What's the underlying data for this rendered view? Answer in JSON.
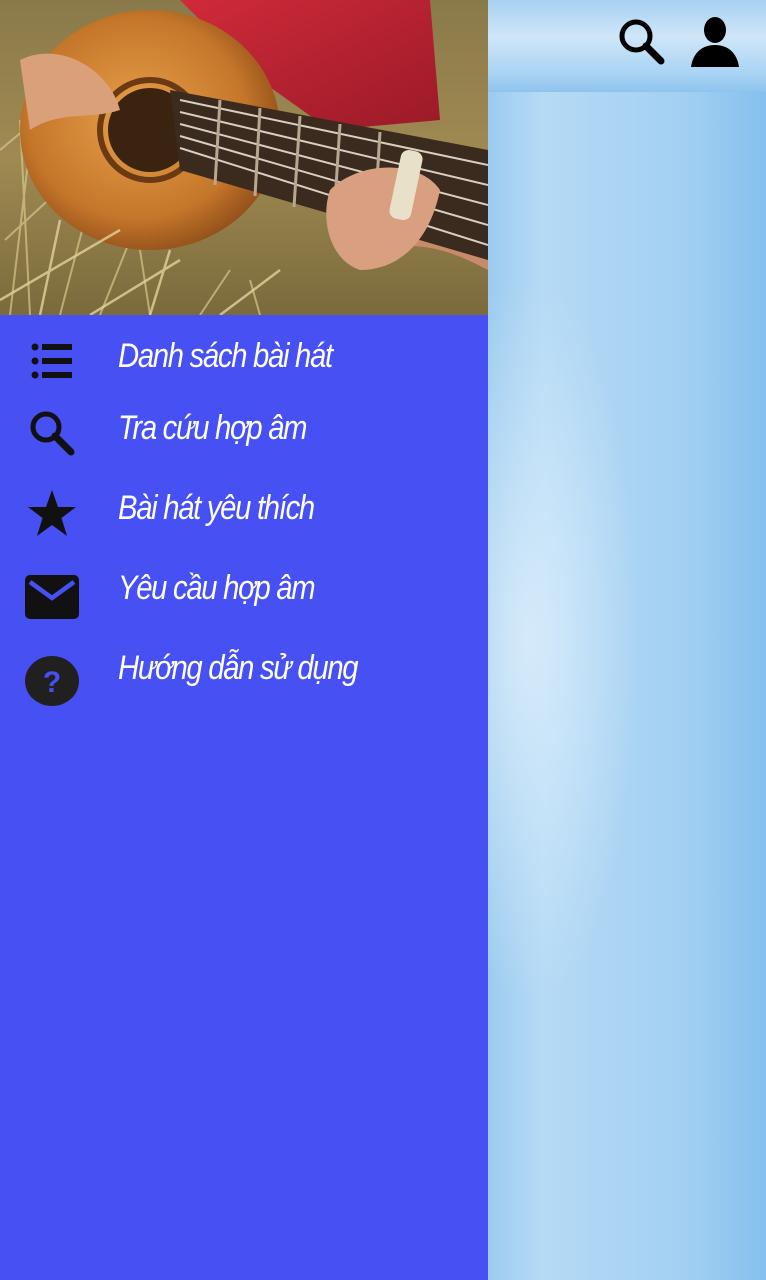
{
  "topbar": {
    "search_icon": "search-icon",
    "user_icon": "user-icon"
  },
  "drawer": {
    "header_image": "guitar-photo",
    "items": [
      {
        "label": "Danh sách bài hát",
        "icon": "list-icon"
      },
      {
        "label": "Tra cứu hợp âm",
        "icon": "search-icon"
      },
      {
        "label": "Bài hát yêu thích",
        "icon": "star-icon"
      },
      {
        "label": "Yêu cầu hợp âm",
        "icon": "mail-icon"
      },
      {
        "label": "Hướng dẫn sử dụng",
        "icon": "help-icon"
      }
    ]
  },
  "colors": {
    "drawer_bg": "#4750f3",
    "icon_dark": "#111111",
    "label_text": "#ffffff",
    "sky": "#a6d2f2"
  }
}
